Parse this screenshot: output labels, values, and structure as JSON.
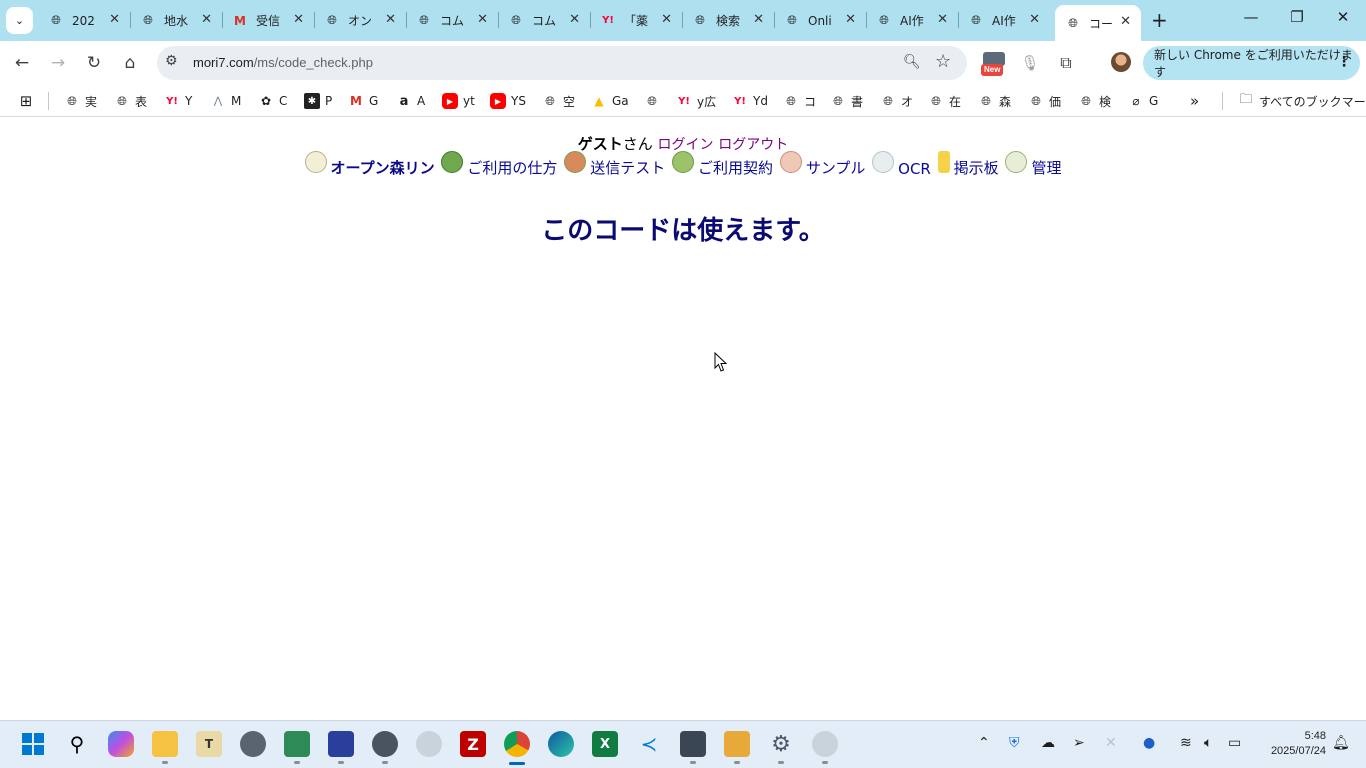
{
  "browser": {
    "tabs": [
      {
        "title": "202",
        "icon": "globe-icon",
        "active": false
      },
      {
        "title": "地水",
        "icon": "globe-icon",
        "active": false
      },
      {
        "title": "受信",
        "icon": "gmail-icon",
        "active": false
      },
      {
        "title": "オン",
        "icon": "globe-icon",
        "active": false
      },
      {
        "title": "コム",
        "icon": "globe-icon",
        "active": false
      },
      {
        "title": "コム",
        "icon": "globe-icon",
        "active": false
      },
      {
        "title": "「薬",
        "icon": "yahoo-icon",
        "active": false
      },
      {
        "title": "検索",
        "icon": "globe-icon",
        "active": false
      },
      {
        "title": "Onli",
        "icon": "globe-icon",
        "active": false
      },
      {
        "title": "AI作",
        "icon": "globe-icon",
        "active": false
      },
      {
        "title": "AI作",
        "icon": "globe-icon",
        "active": false
      },
      {
        "title": "コード",
        "icon": "globe-icon",
        "active": true
      }
    ],
    "url_host": "mori7.com",
    "url_path": "/ms/code_check.php",
    "new_badge": "New",
    "update_button": "新しい Chrome をご利用いただけます",
    "bookmarks": [
      {
        "label": "実",
        "icon": "globe-icon"
      },
      {
        "label": "表",
        "icon": "globe-icon"
      },
      {
        "label": "Y",
        "icon": "yahoo-icon"
      },
      {
        "label": "M",
        "icon": "m-icon"
      },
      {
        "label": "C",
        "icon": "openai-icon"
      },
      {
        "label": "P",
        "icon": "perplexity-icon"
      },
      {
        "label": "G",
        "icon": "gmail-icon"
      },
      {
        "label": "A",
        "icon": "amazon-icon"
      },
      {
        "label": "yt",
        "icon": "youtube-icon"
      },
      {
        "label": "YS",
        "icon": "youtube-icon"
      },
      {
        "label": "空",
        "icon": "globe-icon"
      },
      {
        "label": "Ga",
        "icon": "google-ads-icon"
      },
      {
        "label": "",
        "icon": "globe-icon"
      },
      {
        "label": "y広",
        "icon": "yahoo-icon"
      },
      {
        "label": "Yd",
        "icon": "yahoo-icon"
      },
      {
        "label": "コ",
        "icon": "globe-icon"
      },
      {
        "label": "書",
        "icon": "globe-icon"
      },
      {
        "label": "オ",
        "icon": "globe-icon"
      },
      {
        "label": "在",
        "icon": "globe-icon"
      },
      {
        "label": "森",
        "icon": "globe-icon"
      },
      {
        "label": "価",
        "icon": "globe-icon"
      },
      {
        "label": "検",
        "icon": "globe-icon"
      },
      {
        "label": "G",
        "icon": "leaf-icon"
      }
    ],
    "all_bookmarks": "すべてのブックマーク"
  },
  "page": {
    "guest_name": "ゲスト",
    "guest_suffix": "さん",
    "login": "ログイン",
    "logout": "ログアウト",
    "nav": [
      {
        "label": "オープン森リン",
        "icon": "clock-emblem-icon",
        "bold": true,
        "color": "#f3efd6"
      },
      {
        "label": "ご利用の仕方",
        "icon": "green-badge-icon",
        "bold": false,
        "color": "#6fa84f"
      },
      {
        "label": "送信テスト",
        "icon": "flower-wreath-icon",
        "bold": false,
        "color": "#d98a5c"
      },
      {
        "label": "ご利用契約",
        "icon": "green-flower-icon",
        "bold": false,
        "color": "#9cc26b"
      },
      {
        "label": "サンプル",
        "icon": "girl-icon",
        "bold": false,
        "color": "#f0c8b8"
      },
      {
        "label": "OCR",
        "icon": "sparkle-icon",
        "bold": false,
        "color": "#e8eef0"
      },
      {
        "label": "掲示板",
        "icon": "torch-icon",
        "bold": false,
        "color": "#f5d24a"
      },
      {
        "label": "管理",
        "icon": "clock-emblem-icon",
        "bold": false,
        "color": "#e6eed8"
      }
    ],
    "headline": "このコードは使えます。"
  },
  "taskbar": {
    "time": "5:48",
    "date": "2025/07/24"
  }
}
